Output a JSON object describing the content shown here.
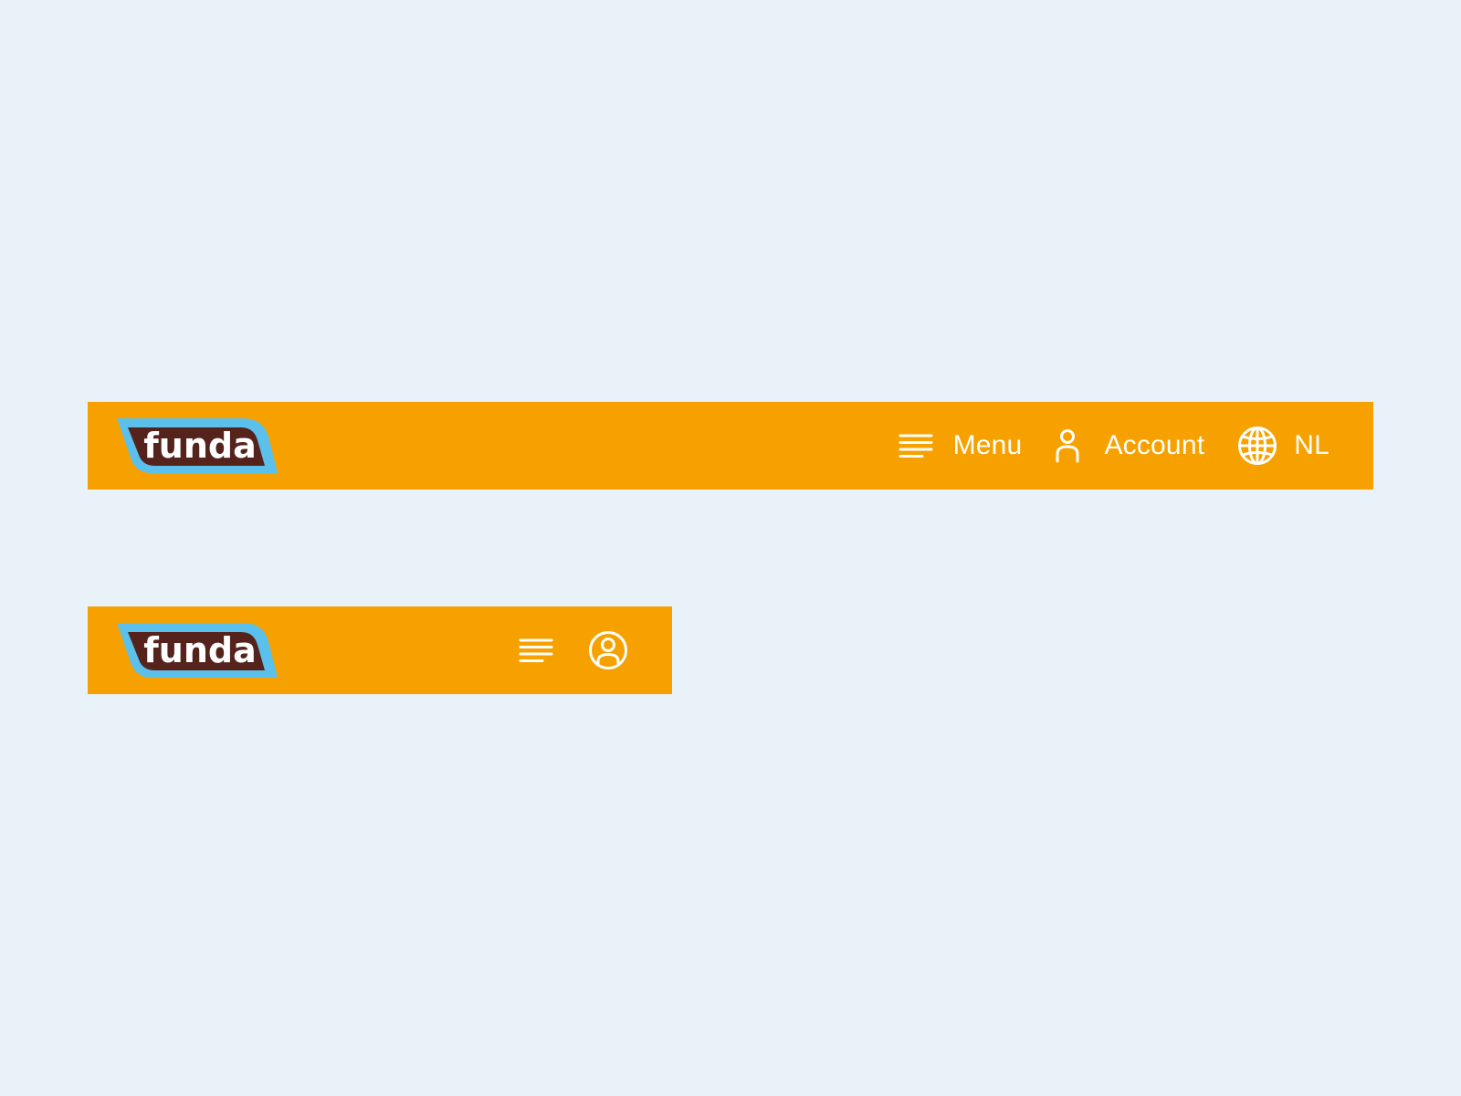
{
  "brand": {
    "name": "funda",
    "colors": {
      "bar": "#f7a100",
      "logo_fill": "#55231c",
      "logo_border": "#5bc0eb",
      "text": "#ffffff",
      "page_background": "#e8f2f8"
    }
  },
  "desktop_header": {
    "logo_text": "funda",
    "nav": [
      {
        "icon": "menu-icon",
        "label": "Menu"
      },
      {
        "icon": "user-icon",
        "label": "Account"
      },
      {
        "icon": "globe-icon",
        "label": "NL"
      }
    ]
  },
  "mobile_header": {
    "logo_text": "funda",
    "nav": [
      {
        "icon": "menu-icon"
      },
      {
        "icon": "user-circle-icon"
      }
    ]
  }
}
